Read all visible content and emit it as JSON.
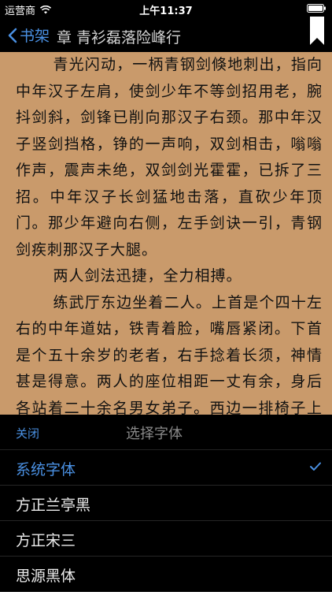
{
  "status_bar": {
    "carrier": "运营商",
    "time": "上午11:37"
  },
  "nav": {
    "back_label": "书架",
    "chapter_title": "章 青衫磊落险峰行"
  },
  "reader": {
    "paragraphs": [
      "青光闪动，一柄青钢剑倏地刺出，指向中年汉子左肩，使剑少年不等剑招用老，腕抖剑斜，剑锋已削向那汉子右颈。那中年汉子竖剑挡格，铮的一声响，双剑相击，嗡嗡作声，震声未绝，双剑剑光霍霍，已拆了三招。中年汉子长剑猛地击落，直砍少年顶门。那少年避向右侧，左手剑诀一引，青钢剑疾刺那汉子大腿。",
      "两人剑法迅捷，全力相搏。",
      "练武厅东边坐着二人。上首是个四十左右的中年道姑，铁青着脸，嘴唇紧闭。下首是个五十余岁的老者，右手捻着长须，神情甚是得意。两人的座位相距一丈有余，身后各站着二十余名男女弟子。西边一排椅子上坐着十余位宾客。东西双方"
    ]
  },
  "font_panel": {
    "close_label": "关闭",
    "title": "选择字体",
    "options": [
      {
        "label": "系统字体",
        "selected": true
      },
      {
        "label": "方正兰亭黑",
        "selected": false
      },
      {
        "label": "方正宋三",
        "selected": false
      },
      {
        "label": "思源黑体",
        "selected": false
      }
    ],
    "accent_color": "#4a90e2"
  },
  "colors": {
    "page_background": "#c99a6b",
    "bar_background": "#000000"
  }
}
